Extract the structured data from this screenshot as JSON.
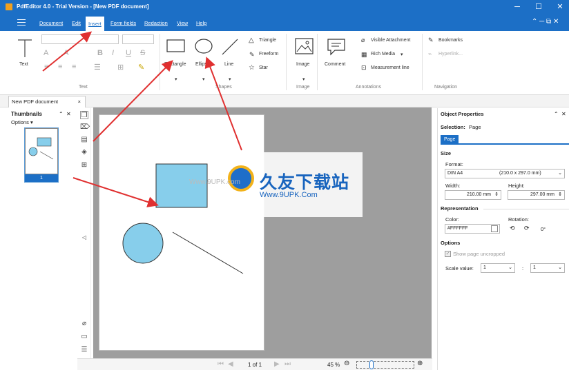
{
  "window": {
    "title": "PdfEditor 4.0 - Trial Version - [New PDF document]",
    "min": "─",
    "max": "☐",
    "close": "✕"
  },
  "menu": {
    "items": [
      "Document",
      "Edit",
      "Insert",
      "Form fields",
      "Redaction",
      "View",
      "Help"
    ],
    "active": "Insert",
    "right_icons": "⌃ ─ ⧉ ✕"
  },
  "ribbon": {
    "text_button": "Text",
    "text_group": "Text",
    "shapes": {
      "rectangle": "Rectangle",
      "ellipse": "Ellipse",
      "line": "Line",
      "triangle": "Triangle",
      "freeform": "Freeform",
      "star": "Star",
      "group": "Shapes"
    },
    "image": {
      "label": "Image",
      "group": "Image"
    },
    "annotations": {
      "comment": "Comment",
      "visible_attachment": "Visible Attachment",
      "rich_media": "Rich Media",
      "measurement_line": "Measurement line",
      "group": "Annotations"
    },
    "navigation": {
      "bookmarks": "Bookmarks",
      "hyperlink": "Hyperlink...",
      "group": "Navigation"
    }
  },
  "document_tab": {
    "label": "New PDF document",
    "close": "×"
  },
  "thumbnails": {
    "title": "Thumbnails",
    "options": "Options",
    "page_number": "1",
    "pin": "⌃",
    "close": "✕"
  },
  "status": {
    "page_info": "1 of 1",
    "zoom": "45 %"
  },
  "properties": {
    "title": "Object Properties",
    "selection_label": "Selection:",
    "selection_value": "Page",
    "tab": "Page",
    "size_header": "Size",
    "format_label": "Format:",
    "format_value": "DIN A4",
    "format_dims": "(210.0 x 297.0 mm)",
    "width_label": "Width:",
    "width_value": "210.00 mm",
    "height_label": "Height:",
    "height_value": "297.00 mm",
    "representation_header": "Representation",
    "color_label": "Color:",
    "color_value": "#FFFFFF",
    "rotation_label": "Rotation:",
    "rotation_value": "0°",
    "options_header": "Options",
    "show_uncropped": "Show page uncropped",
    "scale_label": "Scale value:",
    "scale_a": "1",
    "scale_sep": ":",
    "scale_b": "1"
  },
  "watermark": {
    "brand": "久友下载站",
    "url": "Www.9UPK.Com",
    "overlay": "Www.9UPK.com"
  },
  "colors": {
    "accent": "#1c6fc6",
    "shape_fill": "#87ceeb",
    "arrow": "#e03030"
  }
}
